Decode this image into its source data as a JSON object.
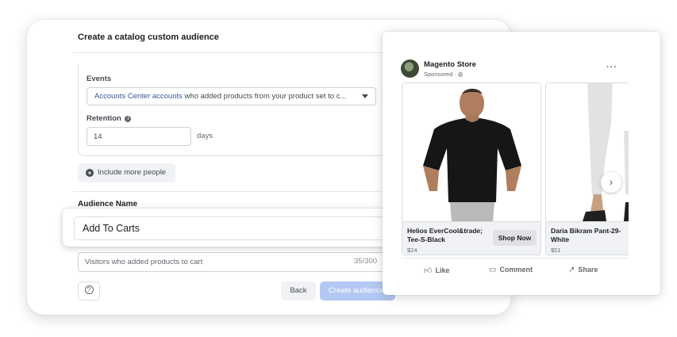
{
  "dialog": {
    "title": "Create a catalog custom audience",
    "events_label": "Events",
    "events_link": "Accounts Center accounts",
    "events_text": " who added products from your product set to c...",
    "retention_label": "Retention",
    "retention_value": "14",
    "retention_suffix": "days",
    "include_more": "Include more people",
    "audience_name_label": "Audience Name",
    "audience_name_value": "Add To Carts",
    "description_value": "Visitors who added products to cart",
    "description_count": "35/300",
    "back_label": "Back",
    "create_label": "Create audience"
  },
  "ad": {
    "page_name": "Magento Store",
    "sponsored": "Sponsored · ",
    "products": [
      {
        "name": "Helios EverCool&trade; Tee-S-Black",
        "price": "$24",
        "cta": "Shop Now"
      },
      {
        "name": "Daria Bikram Pant-29-White",
        "price": "$51"
      }
    ],
    "actions": {
      "like": "Like",
      "comment": "Comment",
      "share": "Share"
    }
  },
  "icons": {
    "info": "info-icon",
    "plus": "plus-circle-icon",
    "help": "question-icon",
    "more": "ellipsis-icon",
    "next": "chevron-right-icon",
    "globe": "globe-icon",
    "like": "thumbs-up-icon",
    "comment": "comment-icon",
    "share": "share-icon"
  },
  "colors": {
    "link": "#385898",
    "primary_disabled": "#b3c8f2"
  }
}
